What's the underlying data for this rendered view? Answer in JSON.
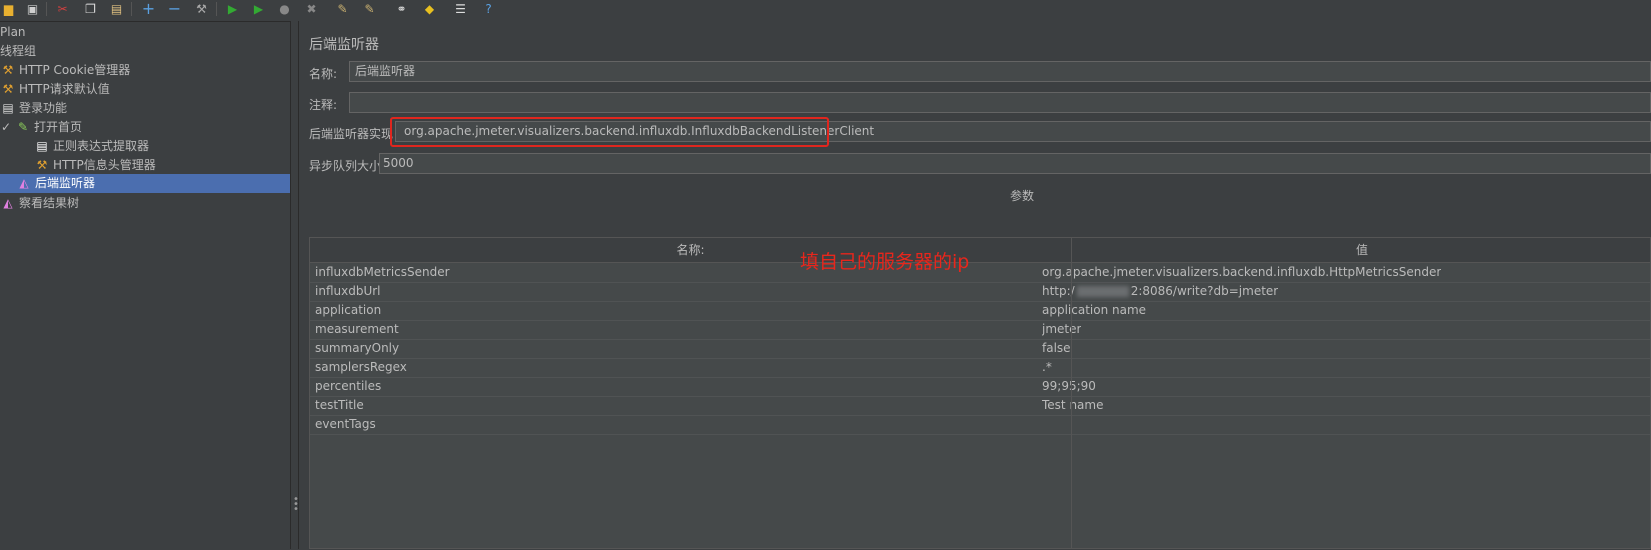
{
  "toolbar": {
    "icons": [
      "open-icon",
      "save-icon",
      "cut-icon",
      "copy-icon",
      "paste-icon",
      "expand-icon",
      "collapse-icon",
      "toggle-icon",
      "start-icon",
      "start-no-pause-icon",
      "stop-icon",
      "shutdown-icon",
      "clear-icon",
      "clear-all-icon",
      "search-icon",
      "reset-search-icon",
      "function-helper-icon",
      "help-icon"
    ]
  },
  "tree": {
    "nodes": [
      {
        "label": "Plan",
        "icon": "test-plan-icon"
      },
      {
        "label": "线程组",
        "icon": ""
      },
      {
        "label": "HTTP Cookie管理器",
        "icon": "wrench-icon"
      },
      {
        "label": "HTTP请求默认值",
        "icon": "wrench-icon"
      },
      {
        "label": "登录功能",
        "icon": "controller-icon"
      },
      {
        "label": "打开首页",
        "icon": "sampler-icon"
      },
      {
        "label": "正则表达式提取器",
        "icon": "extractor-icon"
      },
      {
        "label": "HTTP信息头管理器",
        "icon": "wrench-icon"
      },
      {
        "label": "后端监听器",
        "icon": "listener-icon"
      },
      {
        "label": "察看结果树",
        "icon": "listener-icon"
      }
    ]
  },
  "panel": {
    "title": "后端监听器",
    "name_label": "名称:",
    "name_value": "后端监听器",
    "comment_label": "注释:",
    "comment_value": "",
    "impl_label": "后端监听器实现",
    "impl_value": "org.apache.jmeter.visualizers.backend.influxdb.InfluxdbBackendListenerClient",
    "queue_label": "异步队列大小",
    "queue_value": "5000",
    "params_title": "参数",
    "annotation": "填自己的服务器的ip"
  },
  "params": {
    "headers": [
      "名称:",
      "值"
    ],
    "rows": [
      {
        "name": "influxdbMetricsSender",
        "value": "org.apache.jmeter.visualizers.backend.influxdb.HttpMetricsSender"
      },
      {
        "name": "influxdbUrl",
        "value_prefix": "http:/",
        "value_suffix": "2:8086/write?db=jmeter"
      },
      {
        "name": "application",
        "value": "application name"
      },
      {
        "name": "measurement",
        "value": "jmeter"
      },
      {
        "name": "summaryOnly",
        "value": "false"
      },
      {
        "name": "samplersRegex",
        "value": ".*"
      },
      {
        "name": "percentiles",
        "value": "99;95;90"
      },
      {
        "name": "testTitle",
        "value": "Test name"
      },
      {
        "name": "eventTags",
        "value": ""
      }
    ]
  },
  "colors": {
    "background": "#3c3f41",
    "selection": "#4b6eaf",
    "annotation": "#e8261c"
  }
}
